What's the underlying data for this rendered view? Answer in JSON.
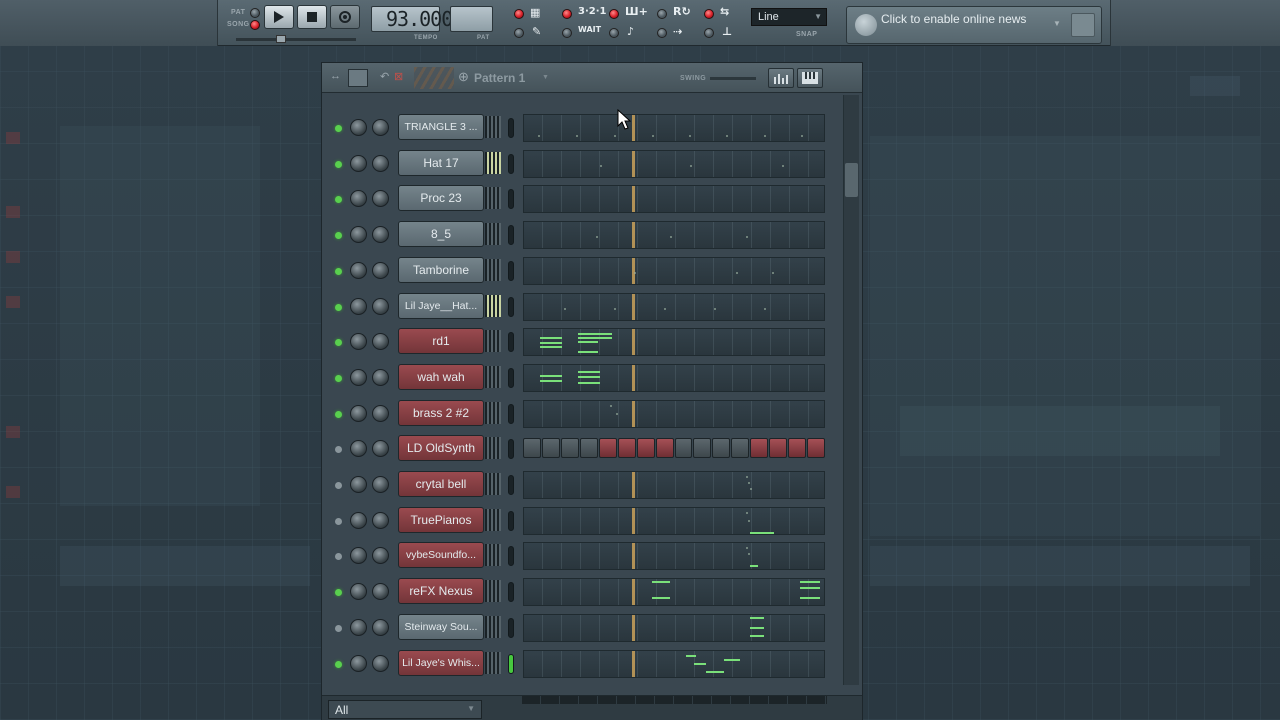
{
  "toolbar": {
    "pat_label": "PAT",
    "song_label": "SONG",
    "tempo_value": "93.000",
    "tempo_label": "TEMPO",
    "pat_number_label": "PAT",
    "mode": "Line",
    "snap_label": "SNAP",
    "news_text": "Click to enable online news"
  },
  "rack": {
    "pattern_title": "Pattern 1",
    "swing_label": "SWING",
    "filter": "All",
    "channels": [
      {
        "name": "TRIANGLE 3 ...",
        "color": "gray",
        "led": "on"
      },
      {
        "name": "Hat 17",
        "color": "gray",
        "led": "on"
      },
      {
        "name": "Proc 23",
        "color": "gray",
        "led": "on"
      },
      {
        "name": "8_5",
        "color": "gray",
        "led": "on"
      },
      {
        "name": "Tamborine",
        "color": "gray",
        "led": "on"
      },
      {
        "name": "Lil Jaye__Hat...",
        "color": "gray",
        "led": "on"
      },
      {
        "name": "rd1",
        "color": "red",
        "led": "on"
      },
      {
        "name": "wah wah",
        "color": "red",
        "led": "on"
      },
      {
        "name": "brass 2 #2",
        "color": "red",
        "led": "on"
      },
      {
        "name": "LD OldSynth",
        "color": "red",
        "led": "dim"
      },
      {
        "name": "crytal bell",
        "color": "red",
        "led": "dim"
      },
      {
        "name": "TruePianos",
        "color": "red",
        "led": "dim"
      },
      {
        "name": "vybeSoundfo...",
        "color": "red",
        "led": "dim"
      },
      {
        "name": "reFX Nexus",
        "color": "red",
        "led": "on"
      },
      {
        "name": "Steinway Sou...",
        "color": "gray",
        "led": "dim"
      },
      {
        "name": "Lil Jaye's Whis...",
        "color": "red",
        "led": "on"
      }
    ]
  },
  "colors": {
    "accent_green": "#59d04e",
    "channel_red": "#8a4146",
    "channel_gray": "#6a7880",
    "playhead": "#c9a15a"
  }
}
